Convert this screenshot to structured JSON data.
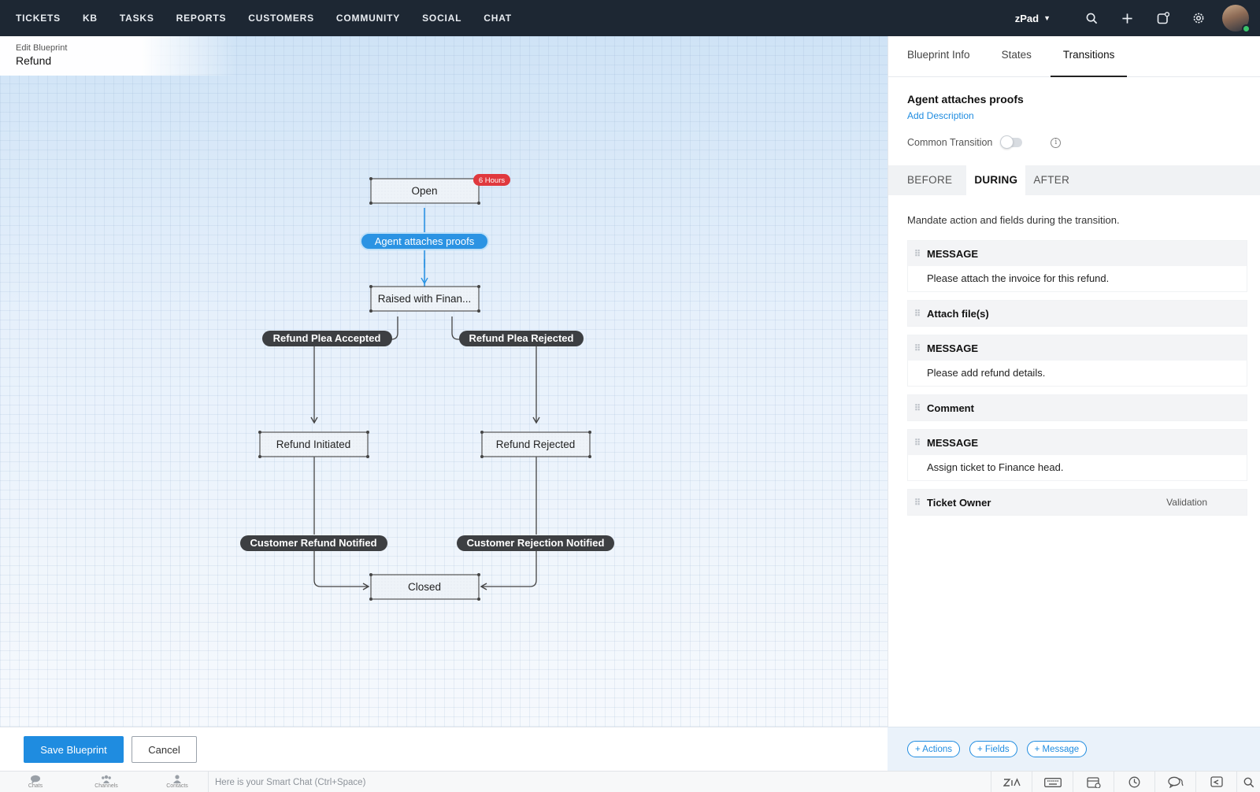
{
  "nav": {
    "items": [
      "TICKETS",
      "KB",
      "TASKS",
      "REPORTS",
      "CUSTOMERS",
      "COMMUNITY",
      "SOCIAL",
      "CHAT"
    ],
    "workspace": "zPad",
    "icons": [
      "search-icon",
      "plus-icon",
      "compose-icon",
      "gear-icon"
    ]
  },
  "blueprint": {
    "edit_label": "Edit Blueprint",
    "name": "Refund"
  },
  "flow": {
    "nodes": {
      "open": "Open",
      "raised": "Raised with Finan...",
      "refund_initiated": "Refund Initiated",
      "refund_rejected": "Refund Rejected",
      "closed": "Closed"
    },
    "sla_badge": "6 Hours",
    "transitions": {
      "agent_attaches": "Agent attaches proofs",
      "plea_accepted": "Refund Plea Accepted",
      "plea_rejected": "Refund Plea Rejected",
      "refund_notified": "Customer Refund Notified",
      "rejection_notified": "Customer Rejection Notified"
    },
    "accent_color": "#2b93e3",
    "badge_color": "#e0393e"
  },
  "panel": {
    "tabs": [
      "Blueprint Info",
      "States",
      "Transitions"
    ],
    "active_tab": "Transitions",
    "transition_title": "Agent attaches proofs",
    "add_description": "Add Description",
    "common_transition_label": "Common Transition",
    "common_transition_on": false,
    "subtabs": [
      "BEFORE",
      "DURING",
      "AFTER"
    ],
    "active_subtab": "DURING",
    "mandate_text": "Mandate action and fields during the transition.",
    "blocks": [
      {
        "title": "MESSAGE",
        "body": "Please attach the invoice for this refund."
      },
      {
        "title": "Attach file(s)"
      },
      {
        "title": "MESSAGE",
        "body": "Please add refund details."
      },
      {
        "title": "Comment"
      },
      {
        "title": "MESSAGE",
        "body": "Assign ticket to Finance head."
      },
      {
        "title": "Ticket Owner",
        "tag": "Validation"
      }
    ],
    "add_buttons": [
      "+ Actions",
      "+ Fields",
      "+ Message"
    ]
  },
  "footer": {
    "save_label": "Save Blueprint",
    "cancel_label": "Cancel"
  },
  "statusbar": {
    "items": [
      "Chats",
      "Channels",
      "Contacts"
    ],
    "smart_chat_placeholder": "Here is your Smart Chat (Ctrl+Space)",
    "right_icons": [
      "zia-icon",
      "keyboard-icon",
      "calendar-icon",
      "clock-icon",
      "chat-bubbles-icon",
      "reply-icon",
      "search-icon"
    ]
  }
}
